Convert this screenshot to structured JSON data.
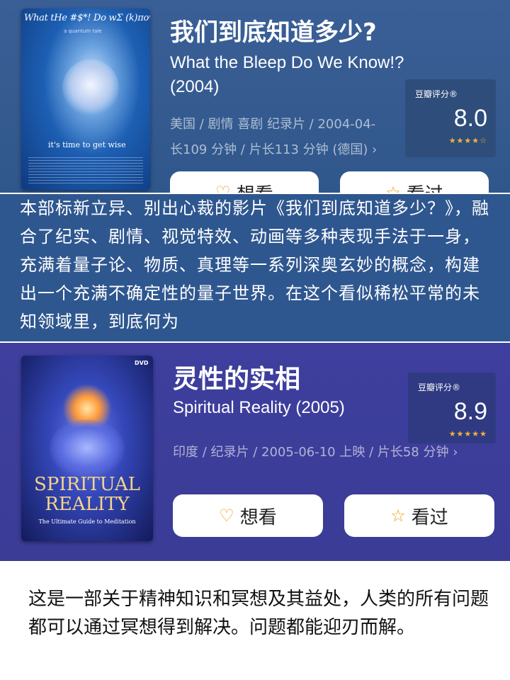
{
  "card1": {
    "title": "我们到底知道多少?",
    "original_title": "What the Bleep Do We Know!? (2004)",
    "meta_line1": "美国 / 剧情 喜剧 纪录片 / 2004-04-",
    "meta_line2": "长109 分钟 / 片长113 分钟 (德国) ›",
    "rating_label": "豆瓣评分®",
    "rating_score": "8.0",
    "rating_stars": "★★★★☆",
    "rating_value": 4,
    "want_label": "想看",
    "seen_label": "看过",
    "poster_title": "What tHe #$*! Do wΣ (k)πow!?",
    "poster_subtitle": "a quantum tale",
    "poster_tagline": "it's time to get wise"
  },
  "band": {
    "text": "本部标新立异、别出心裁的影片《我们到底知道多少？》，融合了纪实、剧情、视觉特效、动画等多种表现手法于一身，充满着量子论、物质、真理等一系列深奥玄妙的概念，构建出一个充满不确定性的量子世界。在这个看似稀松平常的未知领域里，到底何为"
  },
  "card2": {
    "title": "灵性的实相",
    "original_title": "Spiritual Reality (2005)",
    "meta": "印度 / 纪录片 / 2005-06-10 上映 / 片长58 分钟 ›",
    "rating_label": "豆瓣评分®",
    "rating_score": "8.9",
    "rating_stars": "★★★★★",
    "rating_value": 4.5,
    "want_label": "想看",
    "seen_label": "看过",
    "poster_title": "SPIRITUAL REALITY",
    "poster_subtitle": "The Ultimate Guide to Meditation",
    "poster_badge": "DVD"
  },
  "bottom": {
    "text": "这是一部关于精神知识和冥想及其益处，人类的所有问题都可以通过冥想得到解决。问题都能迎刃而解。"
  },
  "icons": {
    "want": "heart-plus-icon",
    "seen": "star-outline-icon",
    "chevron": "chevron-right-icon"
  },
  "colors": {
    "card1_bg": "#3a5f96",
    "band_bg": "#2f578f",
    "card2_bg": "#3e3f9e",
    "accent_icon": "#f0a020",
    "star": "#f2b43a"
  }
}
